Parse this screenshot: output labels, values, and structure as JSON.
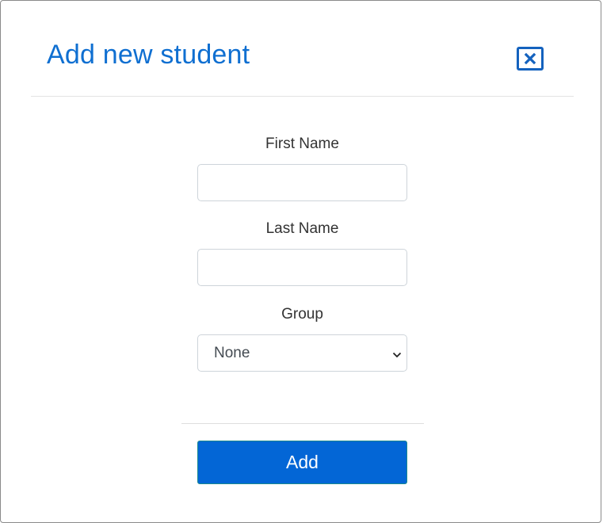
{
  "modal": {
    "title": "Add new student",
    "close_icon": "close-icon"
  },
  "form": {
    "first_name": {
      "label": "First Name",
      "value": "",
      "placeholder": ""
    },
    "last_name": {
      "label": "Last Name",
      "value": "",
      "placeholder": ""
    },
    "group": {
      "label": "Group",
      "selected": "None",
      "icon": "chevron-down-icon"
    },
    "submit_label": "Add"
  },
  "colors": {
    "title": "#0f6fd1",
    "close_border": "#1462be",
    "primary_button": "#0366d6",
    "text": "#333333"
  }
}
